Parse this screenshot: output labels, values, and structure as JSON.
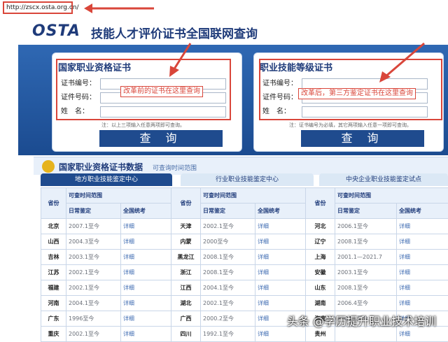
{
  "url": "http://zscx.osta.org.cn/",
  "logo": "OSTA",
  "site_title": "技能人才评价证书全国联网查询",
  "left_panel": {
    "title": "国家职业资格证书",
    "fields": [
      "证书编号：",
      "证件号码：",
      "姓　名："
    ],
    "note": "注：以上三项输入任意两项即可查询。",
    "button": "查 询",
    "annotation": "改革前的证书在这里查询"
  },
  "right_panel": {
    "title": "职业技能等级证书",
    "fields": [
      "证书编号：",
      "证件号码：",
      "姓　名："
    ],
    "note": "注：证书编号为必填，其它两项输入任意一项即可查询。",
    "button": "查 询",
    "annotation": "改革后，第三方鉴定证书在这里查询"
  },
  "data_section": {
    "title": "国家职业资格证书数据",
    "subtitle": "可查询时间范围"
  },
  "tabs": [
    "地方职业技能鉴定中心",
    "行业职业技能鉴定中心",
    "中央企业职业技能鉴定试点"
  ],
  "table": {
    "col_province": "省份",
    "col_range": "可查时间范围",
    "col_daily": "日常鉴定",
    "col_national": "全国统考",
    "detail": "详细",
    "rows": [
      [
        {
          "p": "北京",
          "t": "2007.1至今"
        },
        {
          "p": "天津",
          "t": "2002.1至今"
        },
        {
          "p": "河北",
          "t": "2006.1至今"
        }
      ],
      [
        {
          "p": "山西",
          "t": "2004.3至今"
        },
        {
          "p": "内蒙",
          "t": "2000至今"
        },
        {
          "p": "辽宁",
          "t": "2008.1至今"
        }
      ],
      [
        {
          "p": "吉林",
          "t": "2003.1至今"
        },
        {
          "p": "黑龙江",
          "t": "2008.1至今"
        },
        {
          "p": "上海",
          "t": "2001.1—2021.7"
        }
      ],
      [
        {
          "p": "江苏",
          "t": "2002.1至今"
        },
        {
          "p": "浙江",
          "t": "2008.1至今"
        },
        {
          "p": "安徽",
          "t": "2003.1至今"
        }
      ],
      [
        {
          "p": "福建",
          "t": "2002.1至今"
        },
        {
          "p": "江西",
          "t": "2004.1至今"
        },
        {
          "p": "山东",
          "t": "2008.1至今"
        }
      ],
      [
        {
          "p": "河南",
          "t": "2004.1至今"
        },
        {
          "p": "湖北",
          "t": "2002.1至今"
        },
        {
          "p": "湖南",
          "t": "2006.4至今"
        }
      ],
      [
        {
          "p": "广东",
          "t": "1996至今"
        },
        {
          "p": "广西",
          "t": "2000.2至今"
        },
        {
          "p": "海南",
          "t": "2003.1至今"
        }
      ],
      [
        {
          "p": "重庆",
          "t": "2002.1至今"
        },
        {
          "p": "四川",
          "t": "1992.1至今"
        },
        {
          "p": "贵州",
          "t": ""
        }
      ]
    ]
  },
  "watermark": "头条 @学历提升职业技术培训",
  "colors": {
    "primary": "#1f4b8e",
    "annotation": "#d9463a",
    "hero": "#2f68b3"
  }
}
